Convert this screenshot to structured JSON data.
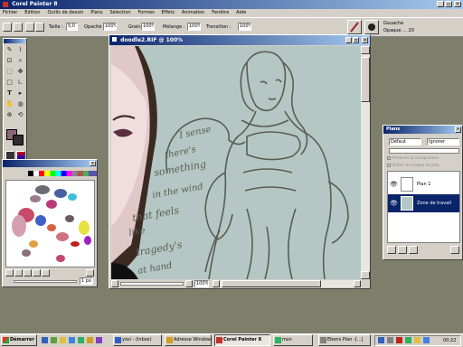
{
  "app": {
    "title": "Corel Painter 8"
  },
  "menu": [
    "Fichier",
    "Edition",
    "Outils de dessin",
    "Plans",
    "Sélection",
    "Formes",
    "Effets",
    "Animation",
    "Fenêtre",
    "Aide"
  ],
  "property_bar": {
    "size_label": "Taille :",
    "size_value": "5,0",
    "opacity_label": "Opacité :",
    "opacity_value": "100%",
    "grain_label": "Grain :",
    "grain_value": "100%",
    "mixing_label": "Mélange :",
    "mixing_value": "100%",
    "transition_label": "Transition :",
    "transition_value": "100%"
  },
  "brush_selector": {
    "category": "Gouache",
    "variant": "Opaque ... 20"
  },
  "document": {
    "title": "doodle2.RIF @ 100%",
    "zoom": "100%",
    "handwriting": [
      "I sense",
      "there's",
      "something",
      "in the wind",
      "that feels",
      "like",
      "tragedy's",
      "at hand"
    ]
  },
  "palette_window": {
    "size_label": "1 px"
  },
  "layers_panel": {
    "title": "Plans",
    "composite_method": "Défaut",
    "opacity_value": "Ignorer",
    "opt1": "Préserver la transparence",
    "opt2": "Utiliser le masque de plan",
    "layers": [
      {
        "name": "Plan 1",
        "selected": false
      },
      {
        "name": "Zone de travail",
        "selected": true
      }
    ]
  },
  "taskbar": {
    "start_label": "Démarrer",
    "items": [
      "yosi - (Inbox)",
      "Adresse Window",
      "Corel Painter 8",
      "msn"
    ],
    "active_item": "Corel Painter 8",
    "extra": "Ebens Plan -[...]",
    "clock": "00:22"
  },
  "colors": {
    "desktop": "#7d7f6a",
    "title_start": "#0a246a",
    "title_end": "#a6caf0",
    "face": "#d4d0c8",
    "canvas": "#b5c7c4",
    "pencil": "#5a5c53",
    "primary_color": "#8a6a78",
    "secondary_color": "#2e2c2c"
  }
}
